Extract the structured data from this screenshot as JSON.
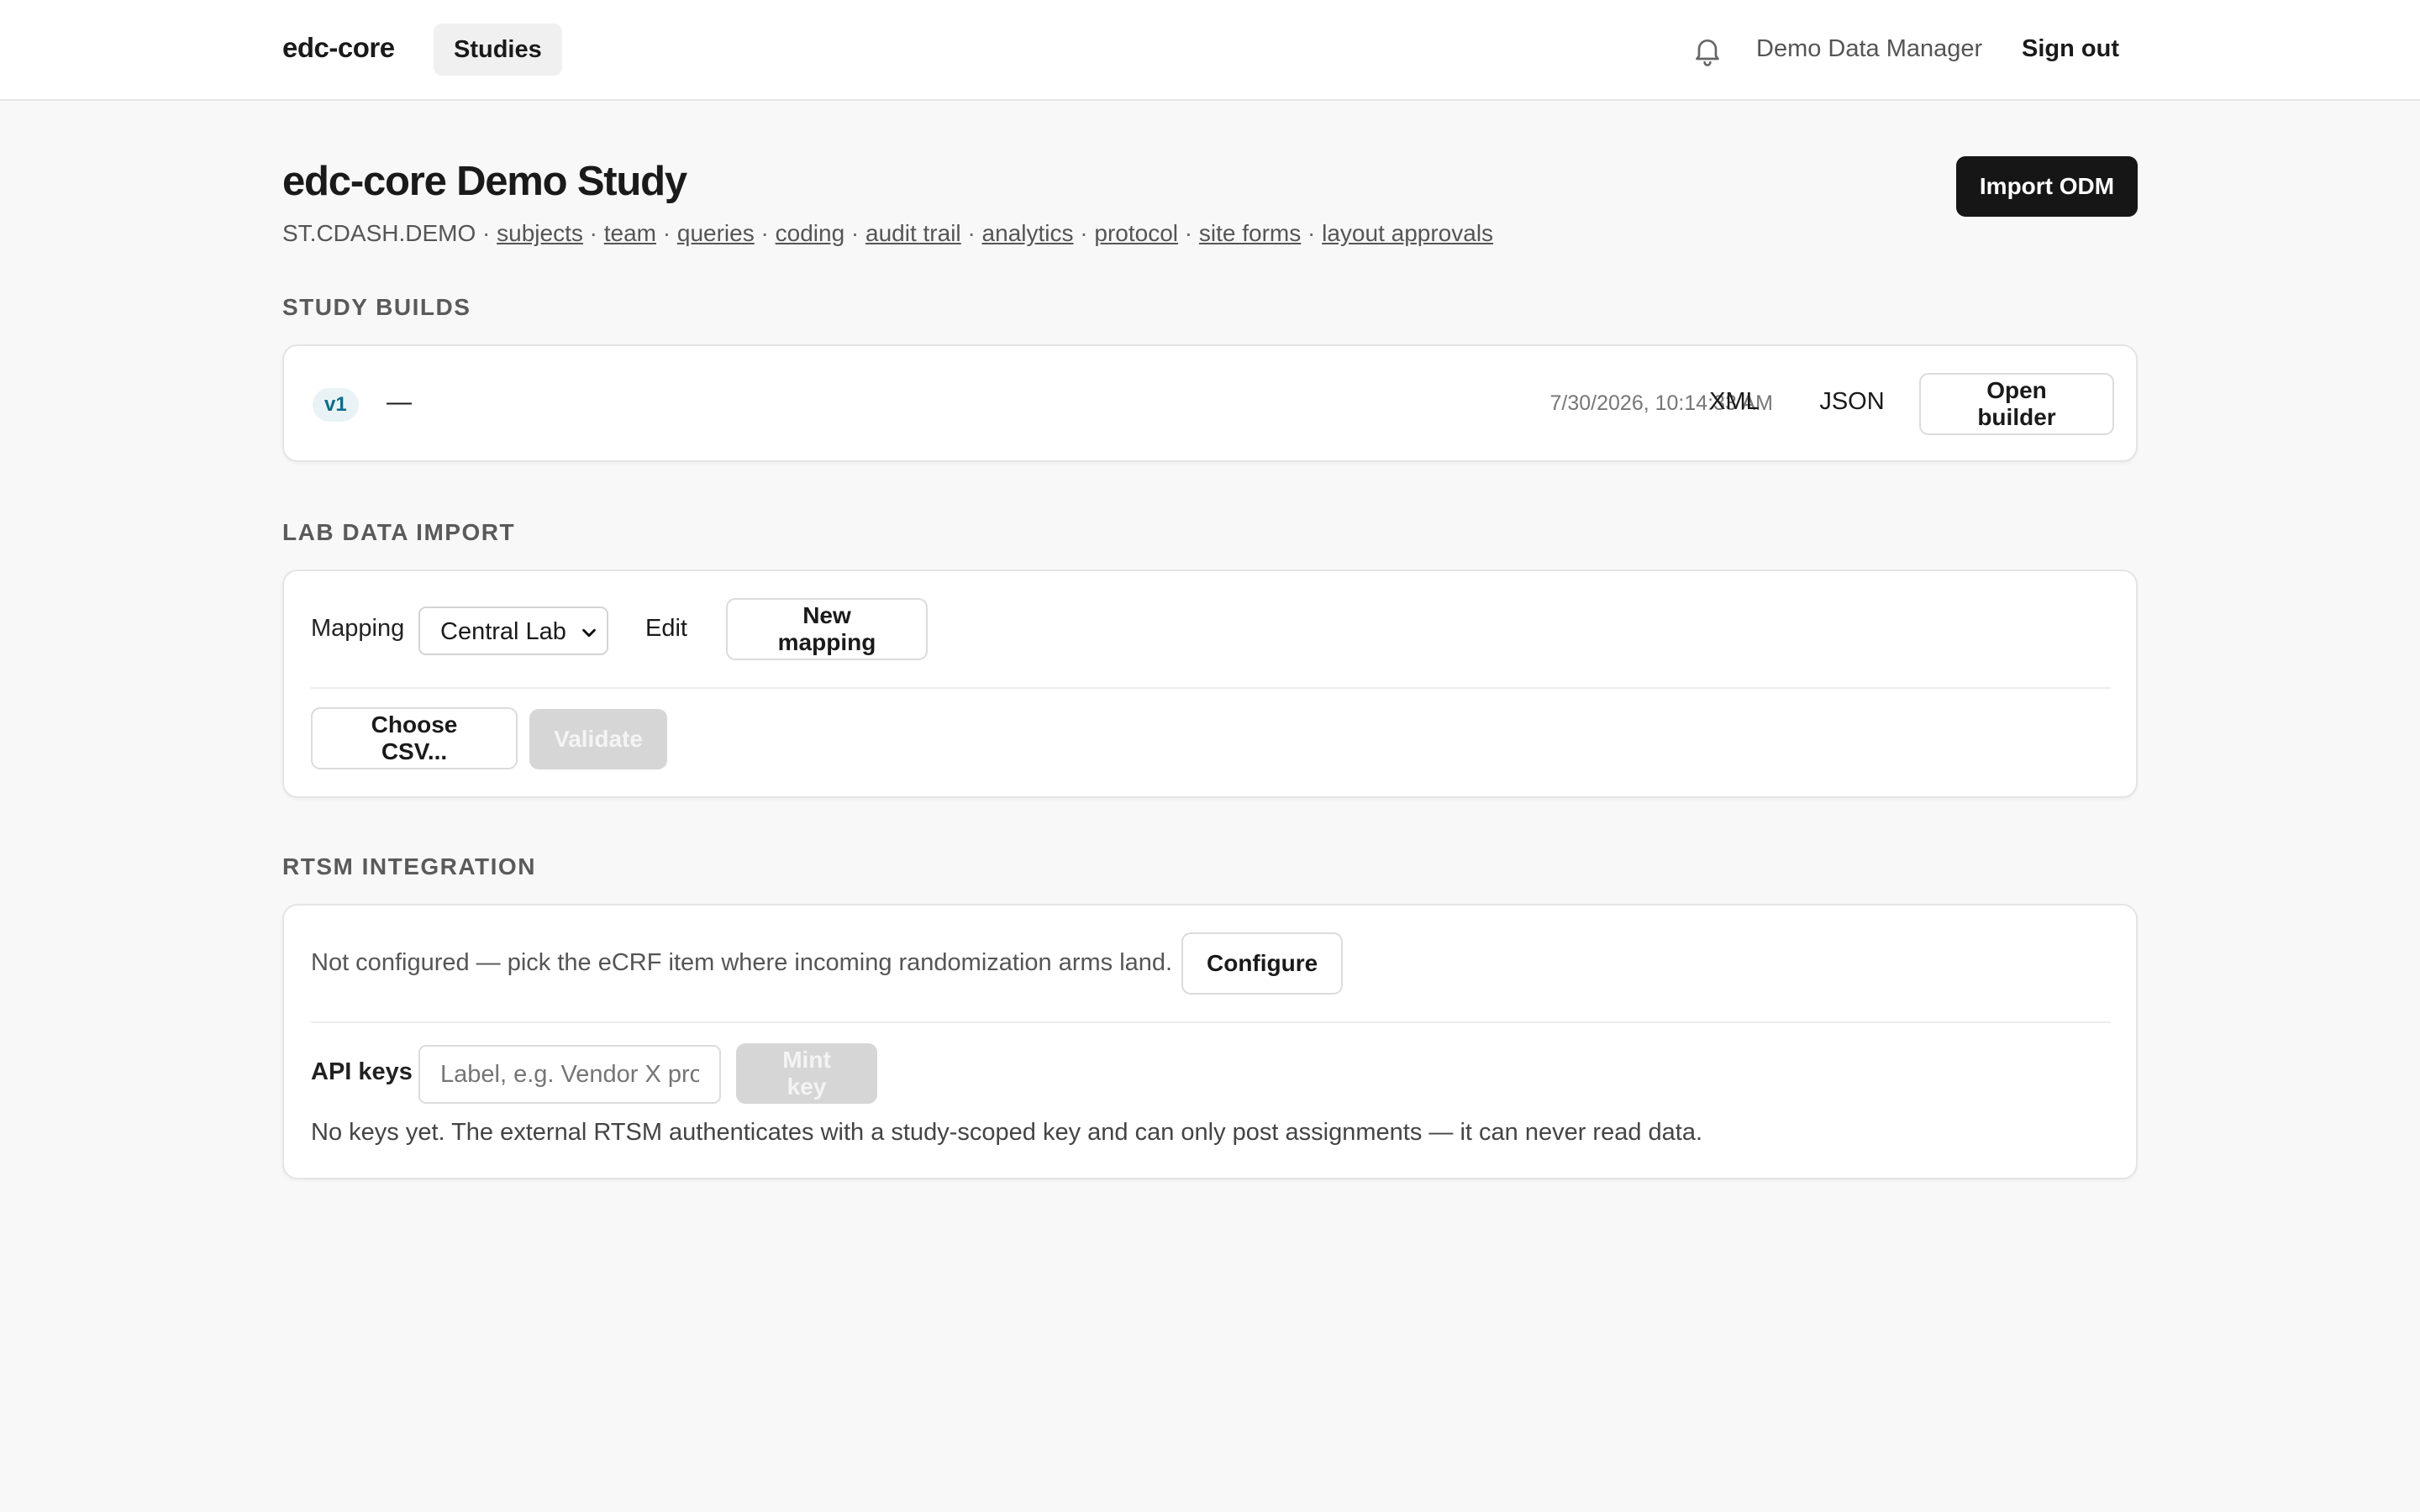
{
  "topbar": {
    "brand": "edc-core",
    "nav_studies": "Studies",
    "user_name": "Demo Data Manager",
    "sign_out": "Sign out"
  },
  "header": {
    "title": "edc-core Demo Study",
    "import_button": "Import ODM",
    "study_code": "ST.CDASH.DEMO",
    "separator": "·",
    "links": [
      "subjects",
      "team",
      "queries",
      "coding",
      "audit trail",
      "analytics",
      "protocol",
      "site forms",
      "layout approvals"
    ]
  },
  "study_builds": {
    "section_title": "STUDY BUILDS",
    "version": "v1",
    "dash": "—",
    "timestamp": "7/30/2026, 10:14:33 AM",
    "xml": "XML",
    "json": "JSON",
    "open_builder": "Open builder"
  },
  "lab_import": {
    "section_title": "LAB DATA IMPORT",
    "mapping_label": "Mapping",
    "mapping_selected": "Central Lab",
    "edit": "Edit",
    "new_mapping": "New mapping",
    "choose_csv": "Choose CSV...",
    "validate": "Validate"
  },
  "rtsm": {
    "section_title": "RTSM INTEGRATION",
    "status_text": "Not configured — pick the eCRF item where incoming randomization arms land.",
    "configure": "Configure",
    "api_keys_label": "API keys",
    "key_placeholder": "Label, e.g. Vendor X prod",
    "mint_key": "Mint key",
    "no_keys_text": "No keys yet. The external RTSM authenticates with a study-scoped key and can only post assignments — it can never read data."
  }
}
